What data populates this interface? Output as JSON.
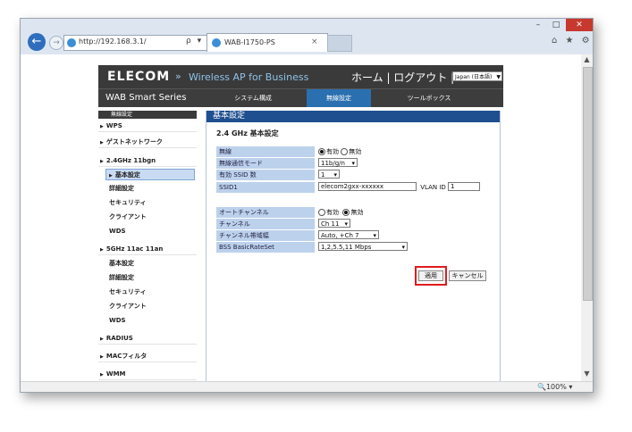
{
  "browser": {
    "window_controls": {
      "minimize": "–",
      "maximize": "□",
      "close": "✕"
    },
    "address": "http://192.168.3.1/",
    "address_tools": "ρ ▾ ¢",
    "tab_title": "WAB-I1750-PS",
    "tab_close": "×",
    "toolbar_icons": "⌂ ★ ⚙",
    "zoom": "🔍100%  ▾"
  },
  "header": {
    "logo": "ELECOM",
    "separator": "»",
    "product": "Wireless AP for Business",
    "links": "ホーム | ログアウト |",
    "language": "Japan (日本語)"
  },
  "nav": {
    "series": "WAB Smart Series",
    "system": "システム構成",
    "wireless": "無線設定",
    "tools": "ツールボックス"
  },
  "sidebar": {
    "header": "無線設定",
    "items": [
      {
        "label": "WPS"
      },
      {
        "label": "ゲストネットワーク"
      },
      {
        "label": "2.4GHz 11bgn"
      },
      {
        "label": "基本設定"
      },
      {
        "label": "詳細設定"
      },
      {
        "label": "セキュリティ"
      },
      {
        "label": "クライアント"
      },
      {
        "label": "WDS"
      },
      {
        "label": "5GHz 11ac 11an"
      },
      {
        "label": "基本設定"
      },
      {
        "label": "詳細設定"
      },
      {
        "label": "セキュリティ"
      },
      {
        "label": "クライアント"
      },
      {
        "label": "WDS"
      },
      {
        "label": "RADIUS"
      },
      {
        "label": "MACフィルタ"
      },
      {
        "label": "WMM"
      }
    ]
  },
  "main": {
    "title": "基本設定",
    "section": "2.4 GHz 基本設定",
    "rows": {
      "wireless": {
        "label": "無線",
        "on": "有効",
        "off": "無効"
      },
      "mode": {
        "label": "無線通信モード",
        "value": "11b/g/n"
      },
      "ssid_count": {
        "label": "有効 SSID 数",
        "value": "1"
      },
      "ssid1": {
        "label": "SSID1",
        "value": "elecom2gxx-xxxxxx",
        "vlan_label": "VLAN ID",
        "vlan_value": "1"
      },
      "auto_channel": {
        "label": "オートチャンネル",
        "on": "有効",
        "off": "無効"
      },
      "channel": {
        "label": "チャンネル",
        "value": "Ch 11"
      },
      "bandwidth": {
        "label": "チャンネル帯域幅",
        "value": "Auto, +Ch 7"
      },
      "basic_rate": {
        "label": "BSS BasicRateSet",
        "value": "1,2,5.5,11 Mbps"
      }
    },
    "apply": "適用",
    "cancel": "キャンセル"
  }
}
